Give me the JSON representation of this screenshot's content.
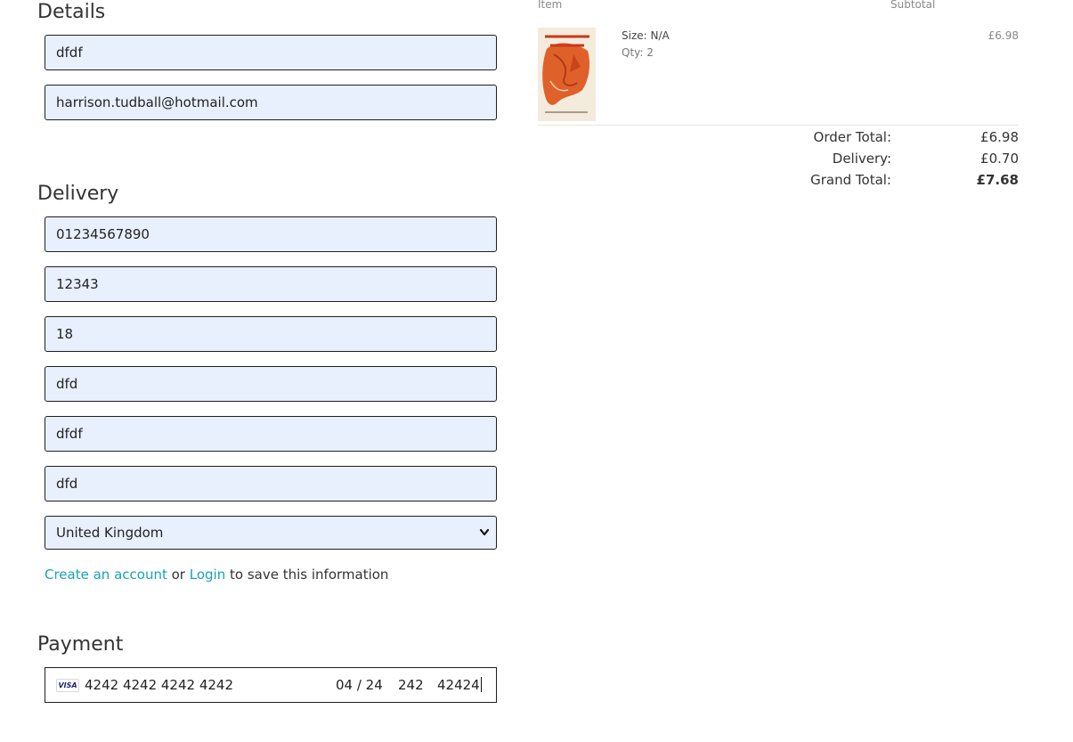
{
  "details": {
    "heading": "Details",
    "full_name": "dfdf",
    "email": "harrison.tudball@hotmail.com"
  },
  "delivery": {
    "heading": "Delivery",
    "phone": "01234567890",
    "postcode": "12343",
    "town_or_city": "18",
    "street_address_1": "dfd",
    "street_address_2": "dfdf",
    "county": "dfd",
    "country": "United Kingdom"
  },
  "account_prompt": {
    "create_link": "Create an account",
    "or_text": "or",
    "login_link": "Login",
    "suffix": "to save this information"
  },
  "payment": {
    "heading": "Payment",
    "card_brand": "VISA",
    "card_number": "4242 4242 4242 4242",
    "expiry": "04 / 24",
    "cvc": "242",
    "postal": "42424"
  },
  "summary": {
    "col_item": "Item",
    "col_subtotal": "Subtotal",
    "item": {
      "size": "Size: N/A",
      "qty": "Qty: 2",
      "subtotal": "£6.98"
    },
    "order_total_label": "Order Total:",
    "order_total": "£6.98",
    "delivery_label": "Delivery:",
    "delivery": "£0.70",
    "grand_total_label": "Grand Total:",
    "grand_total": "£7.68"
  },
  "colors": {
    "link": "#17a2b8",
    "autofill_bg": "#e8f0fe"
  }
}
